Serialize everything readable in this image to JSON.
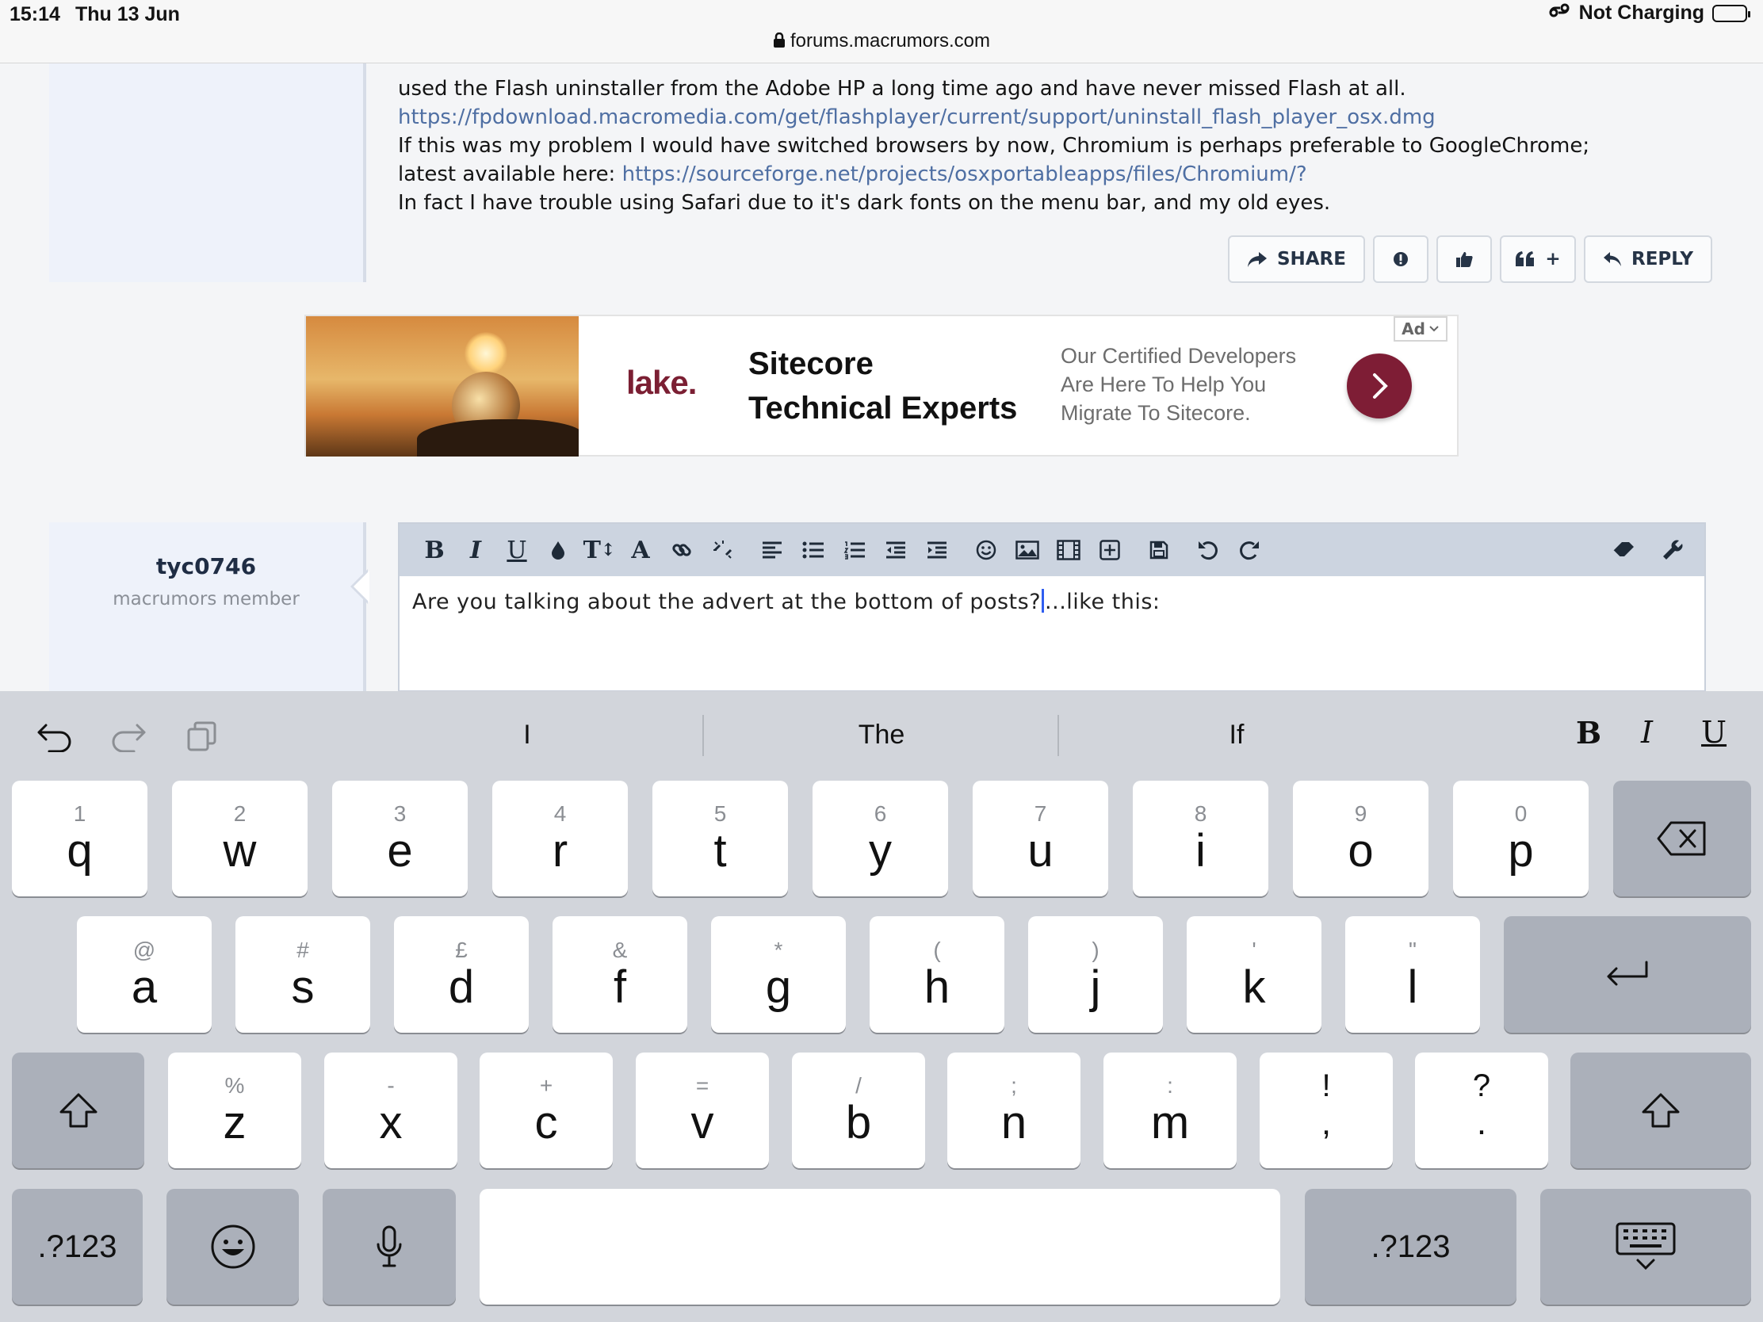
{
  "status_bar": {
    "time": "15:14",
    "date": "Thu 13 Jun",
    "charging": "Not Charging",
    "url": "forums.macrumors.com"
  },
  "previous_post": {
    "line1": "used the Flash uninstaller from the Adobe HP a long time ago and have never missed Flash at all.",
    "link1": "https://fpdownload.macromedia.com/get/flashplayer/current/support/uninstall_flash_player_osx.dmg",
    "line2": "If this was my problem I would have switched browsers by now, Chromium is perhaps preferable to GoogleChrome;",
    "line3_prefix": "latest available here: ",
    "link2": "https://sourceforge.net/projects/osxportableapps/files/Chromium/?",
    "line4": "In fact I have trouble using Safari due to it's dark fonts on the menu bar, and my old eyes.",
    "actions": {
      "share": "SHARE",
      "reply": "REPLY",
      "multiquote_plus": "+"
    }
  },
  "ad": {
    "logo": "lake.",
    "headline_line1": "Sitecore",
    "headline_line2": "Technical Experts",
    "sub_line1": "Our Certified Developers",
    "sub_line2": "Are Here To Help You",
    "sub_line3": "Migrate To Sitecore.",
    "badge": "Ad"
  },
  "reply": {
    "username": "tyc0746",
    "user_title": "macrumors member",
    "text_before_caret": "Are you talking about the advert at the bottom of posts?",
    "text_after_caret": "...like this:",
    "toolbar": {
      "bold": "B",
      "italic": "I",
      "underline": "U",
      "size": "T",
      "font": "A"
    }
  },
  "keyboard": {
    "suggestions": [
      "I",
      "The",
      "If"
    ],
    "format": {
      "bold": "B",
      "italic": "I",
      "underline": "U"
    },
    "row1": [
      {
        "hint": "1",
        "ch": "q"
      },
      {
        "hint": "2",
        "ch": "w"
      },
      {
        "hint": "3",
        "ch": "e"
      },
      {
        "hint": "4",
        "ch": "r"
      },
      {
        "hint": "5",
        "ch": "t"
      },
      {
        "hint": "6",
        "ch": "y"
      },
      {
        "hint": "7",
        "ch": "u"
      },
      {
        "hint": "8",
        "ch": "i"
      },
      {
        "hint": "9",
        "ch": "o"
      },
      {
        "hint": "0",
        "ch": "p"
      }
    ],
    "row2": [
      {
        "hint": "@",
        "ch": "a"
      },
      {
        "hint": "#",
        "ch": "s"
      },
      {
        "hint": "£",
        "ch": "d"
      },
      {
        "hint": "&",
        "ch": "f"
      },
      {
        "hint": "*",
        "ch": "g"
      },
      {
        "hint": "(",
        "ch": "h"
      },
      {
        "hint": ")",
        "ch": "j"
      },
      {
        "hint": "'",
        "ch": "k"
      },
      {
        "hint": "\"",
        "ch": "l"
      }
    ],
    "row3": [
      {
        "hint": "%",
        "ch": "z"
      },
      {
        "hint": "-",
        "ch": "x"
      },
      {
        "hint": "+",
        "ch": "c"
      },
      {
        "hint": "=",
        "ch": "v"
      },
      {
        "hint": "/",
        "ch": "b"
      },
      {
        "hint": ";",
        "ch": "n"
      },
      {
        "hint": ":",
        "ch": "m"
      },
      {
        "hint": "!",
        "ch": ","
      },
      {
        "hint": "?",
        "ch": "."
      }
    ],
    "numbers_label": ".?123"
  }
}
